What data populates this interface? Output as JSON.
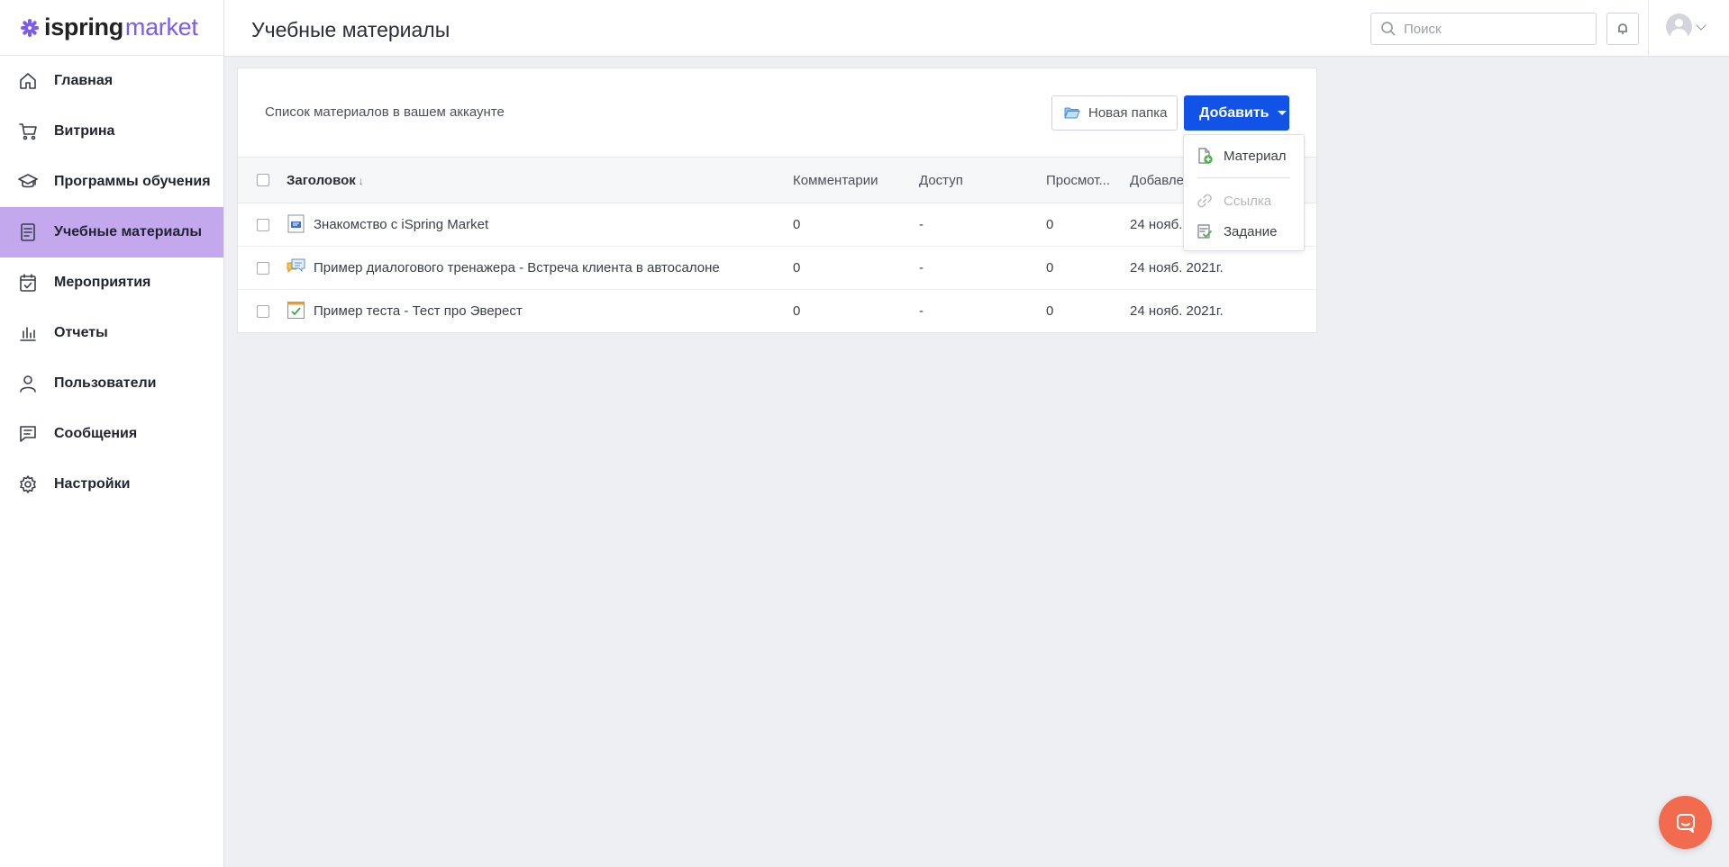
{
  "brand": {
    "logo_part1": "ispring",
    "logo_part2": "market",
    "accent_color": "#7a5cf0",
    "active_nav_color": "#c3a8ee",
    "primary_button_color": "#1153e6",
    "chat_color": "#f26b4f"
  },
  "sidebar": {
    "items": [
      {
        "label": "Главная",
        "icon": "home-icon",
        "active": false
      },
      {
        "label": "Витрина",
        "icon": "cart-icon",
        "active": false
      },
      {
        "label": "Программы обучения",
        "icon": "graduation-cap-icon",
        "active": false
      },
      {
        "label": "Учебные материалы",
        "icon": "document-list-icon",
        "active": true
      },
      {
        "label": "Мероприятия",
        "icon": "calendar-check-icon",
        "active": false
      },
      {
        "label": "Отчеты",
        "icon": "bar-chart-icon",
        "active": false
      },
      {
        "label": "Пользователи",
        "icon": "user-icon",
        "active": false
      },
      {
        "label": "Сообщения",
        "icon": "message-icon",
        "active": false
      },
      {
        "label": "Настройки",
        "icon": "gear-icon",
        "active": false
      }
    ]
  },
  "header": {
    "title": "Учебные материалы",
    "search_placeholder": "Поиск"
  },
  "content": {
    "description": "Список материалов в вашем аккаунте",
    "new_folder_label": "Новая папка",
    "add_label": "Добавить",
    "columns": {
      "title": "Заголовок",
      "sort_indicator": "↓",
      "comments": "Комментарии",
      "access": "Доступ",
      "views": "Просмот...",
      "added": "Добавле"
    },
    "rows": [
      {
        "title": "Знакомство с iSpring Market",
        "icon": "presentation-icon",
        "comments": "0",
        "access": "-",
        "views": "0",
        "added": "24 нояб."
      },
      {
        "title": "Пример диалогового тренажера - Встреча клиента в автосалоне",
        "icon": "dialog-icon",
        "comments": "0",
        "access": "-",
        "views": "0",
        "added": "24 нояб. 2021г."
      },
      {
        "title": "Пример теста - Тест про Эверест",
        "icon": "quiz-icon",
        "comments": "0",
        "access": "-",
        "views": "0",
        "added": "24 нояб. 2021г."
      }
    ]
  },
  "add_menu": {
    "items": [
      {
        "label": "Материал",
        "icon": "file-add-icon",
        "disabled": false
      },
      {
        "label": "Ссылка",
        "icon": "link-icon",
        "disabled": true
      },
      {
        "label": "Задание",
        "icon": "task-icon",
        "disabled": false
      }
    ]
  }
}
